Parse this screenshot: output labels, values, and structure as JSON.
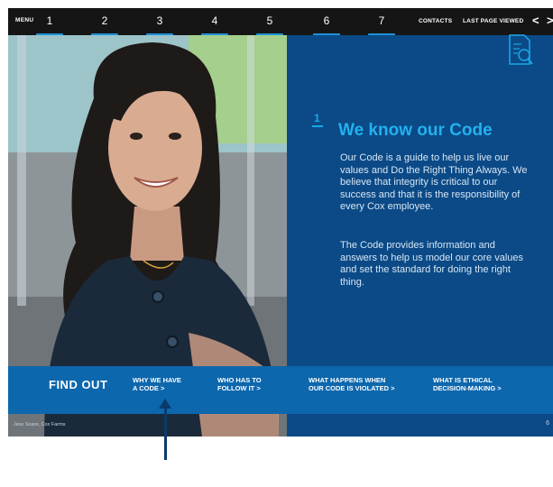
{
  "nav": {
    "menu": "MENU",
    "numbers": [
      "1",
      "2",
      "3",
      "4",
      "5",
      "6",
      "7"
    ],
    "contacts": "CONTACTS",
    "last_viewed": "LAST PAGE VIEWED",
    "prev": "<",
    "next": ">"
  },
  "content": {
    "section_number": "1",
    "title": "We know our Code",
    "paragraph1": "Our Code is a guide to help us live our values and Do the Right Thing Always. We believe that integrity is critical to our success and that it is the responsibility of every Cox employee.",
    "paragraph2": "The Code provides information and answers to help us model our core values and set the standard for doing the right thing."
  },
  "find_out": {
    "label": "FIND OUT",
    "links": [
      {
        "line1": "WHY WE HAVE",
        "line2": "A CODE >"
      },
      {
        "line1": "WHO HAS TO",
        "line2": "FOLLOW IT >"
      },
      {
        "line1": "WHAT HAPPENS WHEN",
        "line2": "OUR CODE IS VIOLATED >"
      },
      {
        "line1": "WHAT IS ETHICAL",
        "line2": "DECISION-MAKING >"
      }
    ]
  },
  "footer": {
    "credit": "Jess Soare, Cox Farms",
    "page_number": "6"
  },
  "colors": {
    "nav_bg": "#151515",
    "accent": "#1e90d6",
    "panel": "#0b4a86",
    "findbar": "#0d67ad",
    "title": "#23b1ef"
  },
  "icons": [
    "document-search-icon",
    "chevron-left-icon",
    "chevron-right-icon"
  ]
}
